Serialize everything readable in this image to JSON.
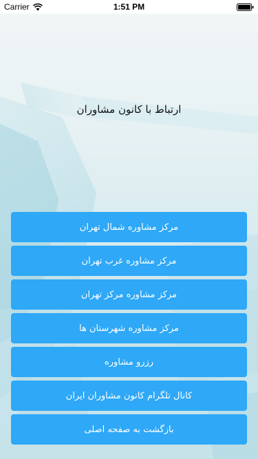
{
  "status_bar": {
    "carrier": "Carrier",
    "time": "1:51 PM",
    "wifi_icon": "wifi-icon",
    "battery_icon": "battery-icon"
  },
  "page": {
    "title": "ارتباط با کانون مشاوران"
  },
  "menu": {
    "items": [
      {
        "label": "مرکز مشاوره شمال تهران"
      },
      {
        "label": "مرکز مشاوره غرب تهران"
      },
      {
        "label": "مرکز مشاوره مرکز تهران"
      },
      {
        "label": "مرکز مشاوره شهرستان ها"
      },
      {
        "label": "رزرو مشاوره"
      },
      {
        "label": "کانال تلگرام کانون مشاوران ایران"
      },
      {
        "label": "بازگشت به صفحه اصلی"
      }
    ]
  },
  "colors": {
    "button": "#2ea8f7",
    "button_text": "#ffffff",
    "status_bar": "#ffffff"
  }
}
